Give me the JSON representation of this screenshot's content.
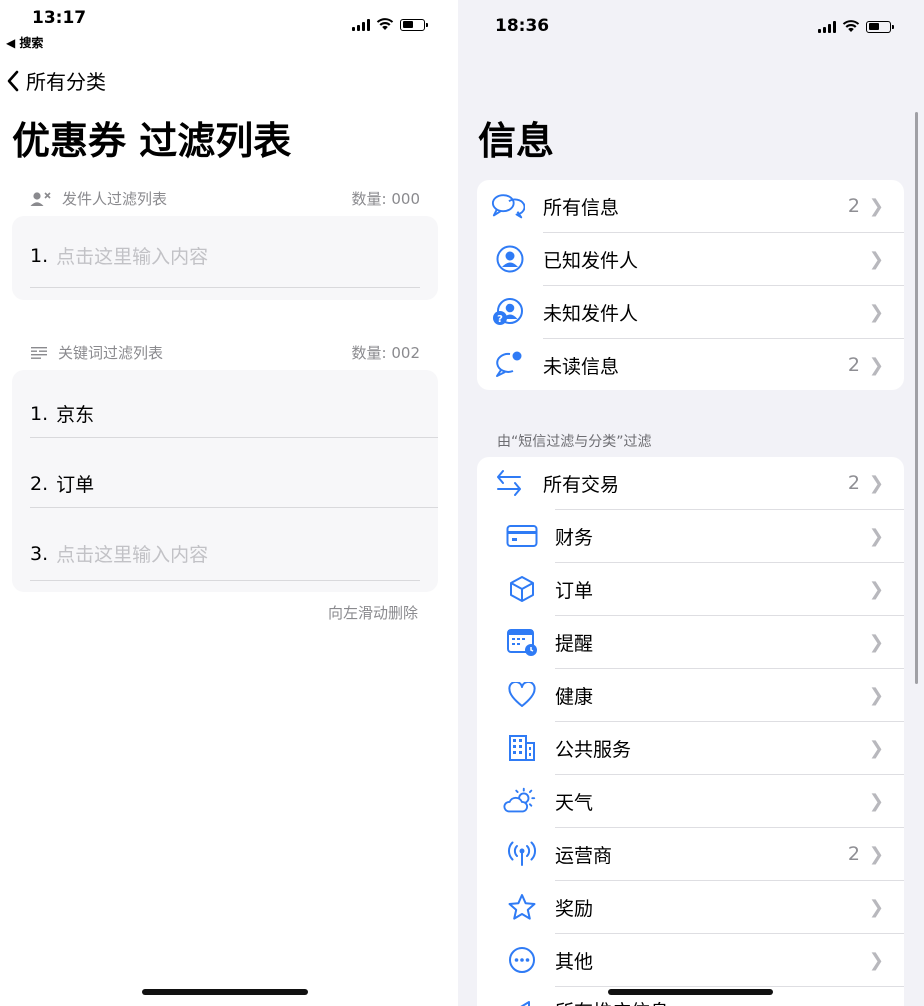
{
  "left": {
    "status": {
      "time": "13:17",
      "back_app": "◀ 搜索"
    },
    "nav": {
      "back_label": "所有分类"
    },
    "title": "优惠券 过滤列表",
    "sender_section": {
      "header": "发件人过滤列表",
      "count": "数量: 000",
      "rows": [
        {
          "num": "1.",
          "text": "点击这里输入内容",
          "placeholder": true
        }
      ]
    },
    "keyword_section": {
      "header": "关键词过滤列表",
      "count": "数量: 002",
      "rows": [
        {
          "num": "1.",
          "text": "京东",
          "placeholder": false
        },
        {
          "num": "2.",
          "text": "订单",
          "placeholder": false
        },
        {
          "num": "3.",
          "text": "点击这里输入内容",
          "placeholder": true
        }
      ]
    },
    "footnote": "向左滑动删除"
  },
  "right": {
    "status": {
      "time": "18:36"
    },
    "title": "信息",
    "group1": [
      {
        "icon": "two-chat-bubbles-icon",
        "label": "所有信息",
        "count": "2"
      },
      {
        "icon": "person-circle-icon",
        "label": "已知发件人",
        "count": ""
      },
      {
        "icon": "person-question-icon",
        "label": "未知发件人",
        "count": ""
      },
      {
        "icon": "chat-bubble-badge-icon",
        "label": "未读信息",
        "count": "2"
      }
    ],
    "filter_caption": "由“短信过滤与分类”过滤",
    "group2": [
      {
        "icon": "arrows-swap-icon",
        "label": "所有交易",
        "count": "2"
      },
      {
        "icon": "credit-card-icon",
        "label": "财务",
        "count": ""
      },
      {
        "icon": "cube-box-icon",
        "label": "订单",
        "count": ""
      },
      {
        "icon": "calendar-clock-icon",
        "label": "提醒",
        "count": ""
      },
      {
        "icon": "heart-icon",
        "label": "健康",
        "count": ""
      },
      {
        "icon": "building-icon",
        "label": "公共服务",
        "count": ""
      },
      {
        "icon": "cloud-sun-icon",
        "label": "天气",
        "count": ""
      },
      {
        "icon": "antenna-icon",
        "label": "运营商",
        "count": "2"
      },
      {
        "icon": "star-icon",
        "label": "奖励",
        "count": ""
      },
      {
        "icon": "ellipsis-circle-icon",
        "label": "其他",
        "count": ""
      }
    ],
    "partial_next_label": "所有推广信息"
  },
  "colors": {
    "accent": "#2f7bf5",
    "background_grouped": "#f2f2f7",
    "secondary_text": "#8a8a8e"
  }
}
